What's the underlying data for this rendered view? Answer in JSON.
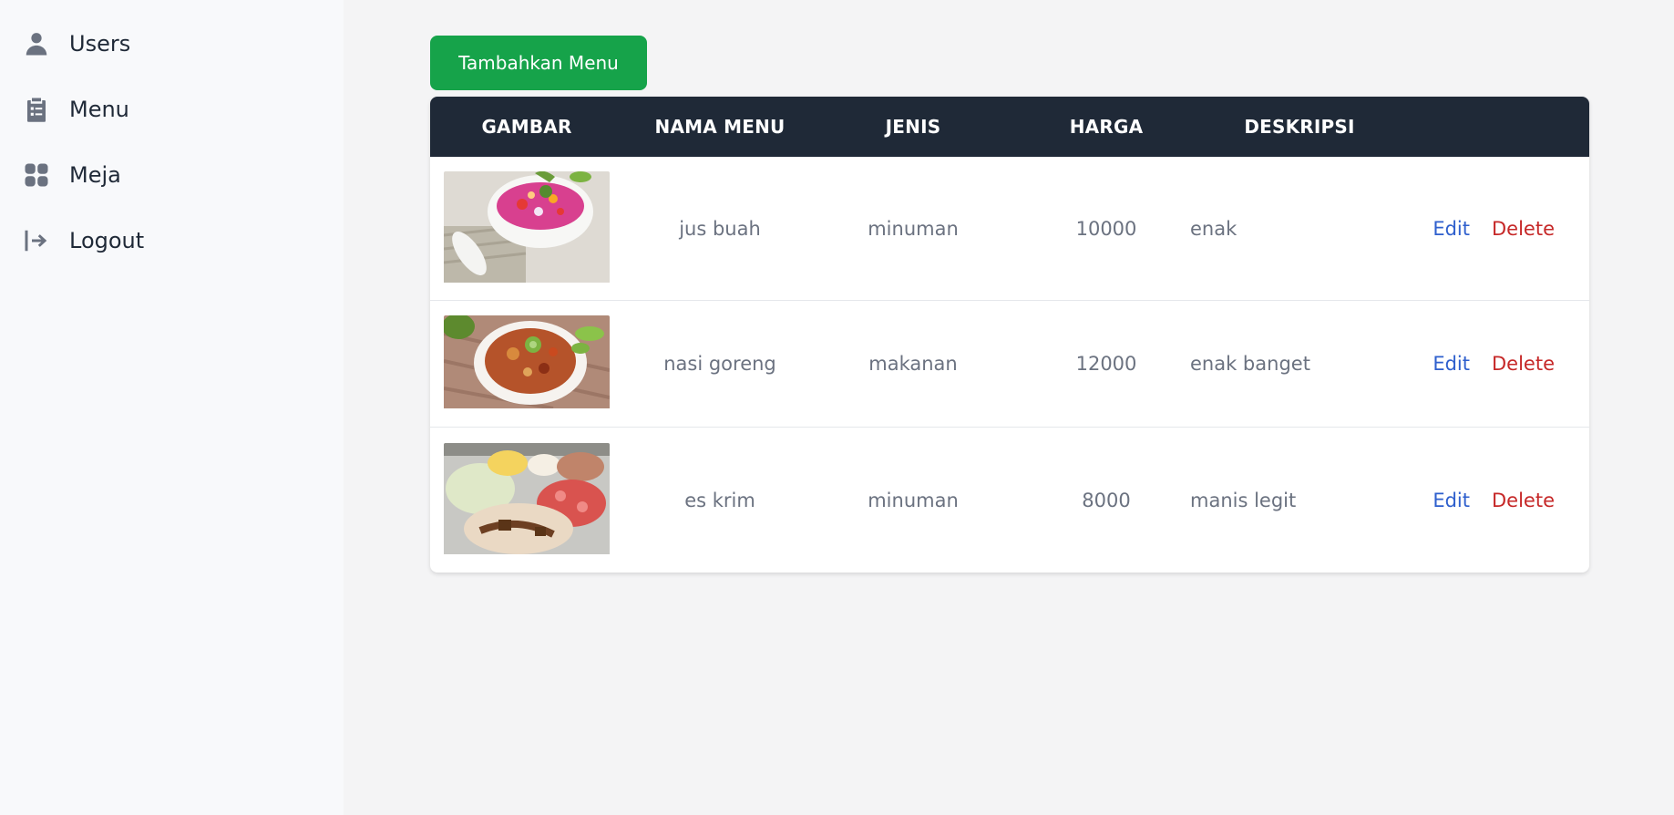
{
  "sidebar": {
    "items": [
      {
        "label": "Users",
        "icon": "user-icon"
      },
      {
        "label": "Menu",
        "icon": "clipboard-list-icon"
      },
      {
        "label": "Meja",
        "icon": "grid-icon"
      },
      {
        "label": "Logout",
        "icon": "logout-arrow-icon"
      }
    ]
  },
  "main": {
    "add_button_label": "Tambahkan Menu",
    "table": {
      "headers": [
        "GAMBAR",
        "NAMA MENU",
        "JENIS",
        "HARGA",
        "DESKRIPSI",
        ""
      ],
      "rows": [
        {
          "image": "fruit-soup-photo",
          "name": "jus buah",
          "type": "minuman",
          "price": "10000",
          "description": "enak"
        },
        {
          "image": "fried-rice-photo",
          "name": "nasi goreng",
          "type": "makanan",
          "price": "12000",
          "description": "enak banget"
        },
        {
          "image": "ice-cream-photo",
          "name": "es krim",
          "type": "minuman",
          "price": "8000",
          "description": "manis legit"
        }
      ],
      "edit_label": "Edit",
      "delete_label": "Delete"
    }
  },
  "colors": {
    "accent_green": "#16a34a",
    "header_dark": "#1f2937",
    "edit_blue": "#2e5fcd",
    "delete_red": "#c62828"
  }
}
